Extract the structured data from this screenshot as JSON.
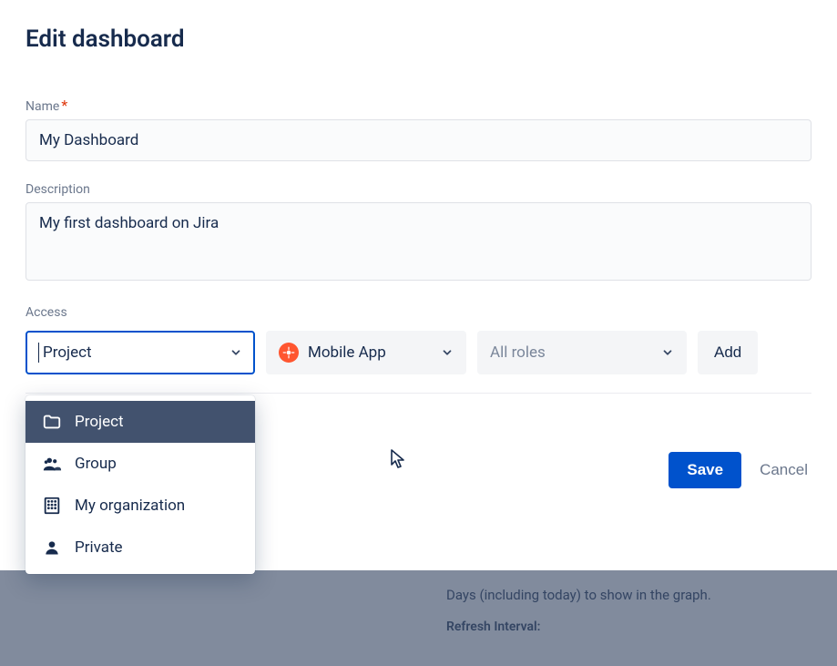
{
  "title": "Edit dashboard",
  "fields": {
    "name": {
      "label": "Name",
      "required": true,
      "value": "My Dashboard"
    },
    "description": {
      "label": "Description",
      "value": "My first dashboard on Jira"
    },
    "access": {
      "label": "Access",
      "type_select": {
        "value": "Project"
      },
      "project_select": {
        "value": "Mobile App"
      },
      "role_select": {
        "placeholder": "All roles"
      },
      "add_button": "Add",
      "dropdown_options": [
        {
          "key": "project",
          "label": "Project",
          "icon": "folder-icon"
        },
        {
          "key": "group",
          "label": "Group",
          "icon": "people-icon"
        },
        {
          "key": "org",
          "label": "My organization",
          "icon": "building-icon"
        },
        {
          "key": "private",
          "label": "Private",
          "icon": "person-icon"
        }
      ],
      "selected_option": "project"
    }
  },
  "actions": {
    "save": "Save",
    "cancel": "Cancel"
  },
  "background": {
    "days_label": "Days (including today) to show in the graph.",
    "refresh_label": "Refresh Interval:"
  }
}
